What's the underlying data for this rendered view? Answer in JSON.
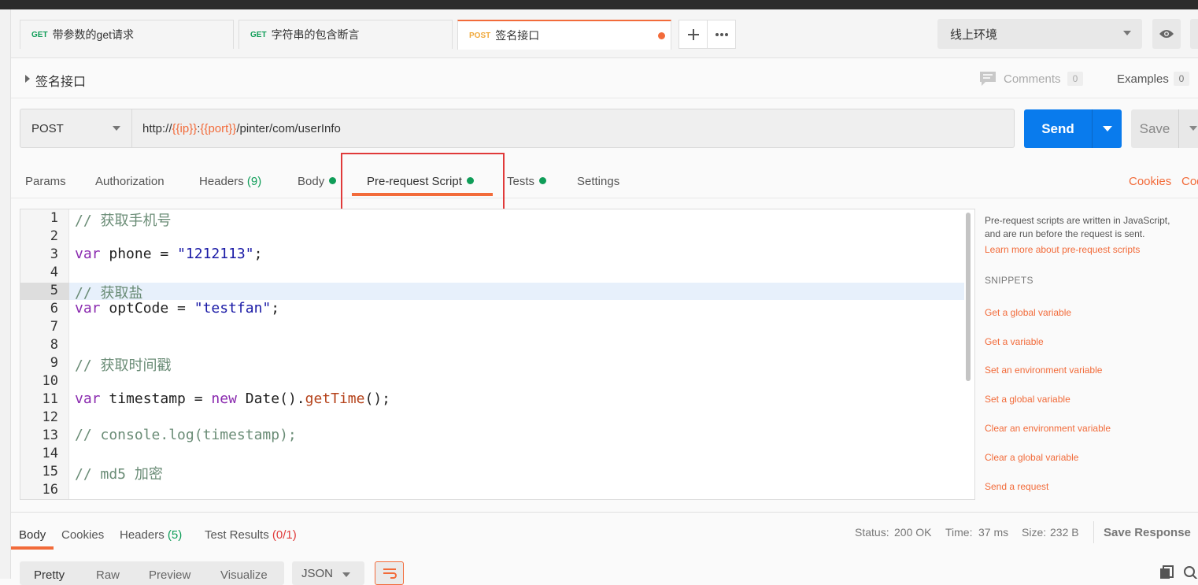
{
  "tabs": [
    {
      "method": "GET",
      "name": "带参数的get请求"
    },
    {
      "method": "GET",
      "name": "字符串的包含断言"
    },
    {
      "method": "POST",
      "name": "签名接口"
    }
  ],
  "environment": {
    "selected": "线上环境"
  },
  "request": {
    "name": "签名接口",
    "method": "POST",
    "url_prefix": "http://",
    "url_var_ip": "{{ip}}",
    "url_colon": ":",
    "url_var_port": "{{port}}",
    "url_path": "/pinter/com/userInfo"
  },
  "header_actions": {
    "comments_label": "Comments",
    "comments_count": "0",
    "examples_label": "Examples",
    "examples_count": "0"
  },
  "buttons": {
    "send": "Send",
    "save": "Save"
  },
  "subtabs": {
    "params": "Params",
    "authorization": "Authorization",
    "headers": "Headers",
    "headers_count": "(9)",
    "body": "Body",
    "prerequest": "Pre-request Script",
    "tests": "Tests",
    "settings": "Settings",
    "cookies": "Cookies",
    "code": "Code"
  },
  "editor": {
    "line_numbers": [
      "1",
      "2",
      "3",
      "4",
      "5",
      "6",
      "7",
      "8",
      "9",
      "10",
      "11",
      "12",
      "13",
      "14",
      "15",
      "16"
    ],
    "lines": {
      "l1": "// 获取手机号",
      "l3_kw": "var",
      "l3_a": " phone = ",
      "l3_str": "\"1212113\"",
      "l3_b": ";",
      "l5": "// 获取盐",
      "l6_kw": "var",
      "l6_a": " optCode = ",
      "l6_str": "\"testfan\"",
      "l6_b": ";",
      "l9": "// 获取时间戳",
      "l11_kw": "var",
      "l11_a": " timestamp = ",
      "l11_kw2": "new",
      "l11_b": " Date().",
      "l11_fn": "getTime",
      "l11_c": "();",
      "l13": "// console.log(timestamp);",
      "l15": "// md5 加密"
    }
  },
  "side_panel": {
    "desc_line1": "Pre-request scripts are written in JavaScript,",
    "desc_line2": "and are run before the request is sent.",
    "learn_more": "Learn more about pre-request scripts",
    "snippets_heading": "SNIPPETS",
    "snippets": [
      "Get a global variable",
      "Get a variable",
      "Set an environment variable",
      "Set a global variable",
      "Clear an environment variable",
      "Clear a global variable",
      "Send a request"
    ]
  },
  "response": {
    "tabs": {
      "body": "Body",
      "cookies": "Cookies",
      "headers": "Headers",
      "headers_count": "(5)",
      "test_results": "Test Results",
      "test_results_count": "(0/1)"
    },
    "status_label": "Status:",
    "status_value": "200 OK",
    "time_label": "Time:",
    "time_value": "37 ms",
    "size_label": "Size:",
    "size_value": "232 B",
    "save_response": "Save Response"
  },
  "body_view": {
    "pretty": "Pretty",
    "raw": "Raw",
    "preview": "Preview",
    "visualize": "Visualize",
    "format": "JSON"
  },
  "colors": {
    "accent": "#f26b3a",
    "send_blue": "#097bed",
    "get_green": "#0f9d58",
    "post_orange": "#f0a93c",
    "highlight_red": "#e03a3a"
  }
}
